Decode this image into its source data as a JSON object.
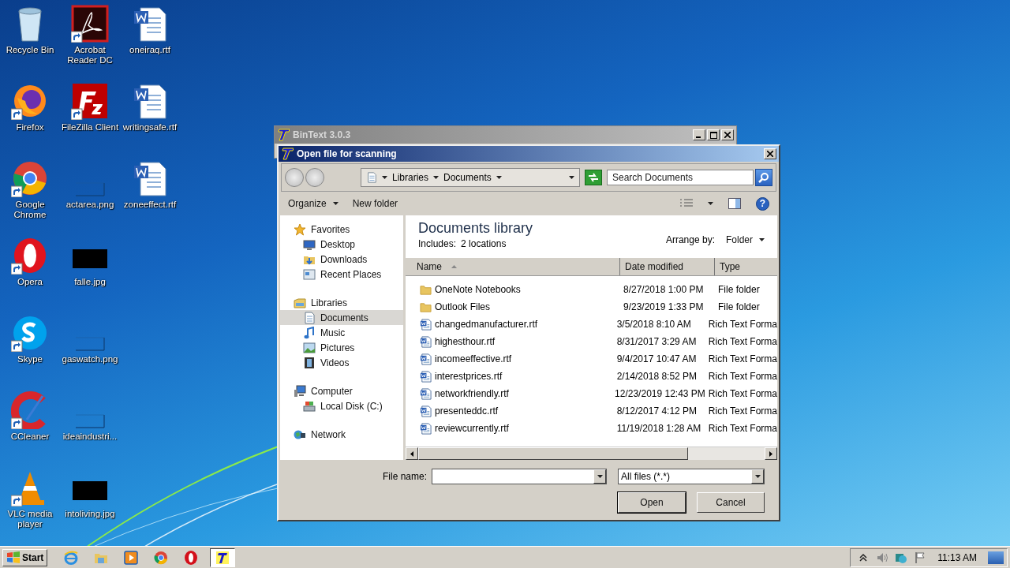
{
  "desktop": {
    "icons": [
      {
        "label": "Recycle Bin",
        "kind": "recycle",
        "shortcut": false
      },
      {
        "label": "Firefox",
        "kind": "firefox",
        "shortcut": true
      },
      {
        "label": "Google Chrome",
        "kind": "chrome",
        "shortcut": true
      },
      {
        "label": "Opera",
        "kind": "opera",
        "shortcut": true
      },
      {
        "label": "Skype",
        "kind": "skype",
        "shortcut": true
      },
      {
        "label": "CCleaner",
        "kind": "ccleaner",
        "shortcut": true
      },
      {
        "label": "VLC media player",
        "kind": "vlc",
        "shortcut": true
      },
      {
        "label": "Acrobat Reader DC",
        "kind": "acrobat",
        "shortcut": true
      },
      {
        "label": "FileZilla Client",
        "kind": "filezilla",
        "shortcut": true
      },
      {
        "label": "actarea.png",
        "kind": "blank",
        "shortcut": false
      },
      {
        "label": "falle.jpg",
        "kind": "dark",
        "shortcut": false
      },
      {
        "label": "gaswatch.png",
        "kind": "blank",
        "shortcut": false
      },
      {
        "label": "ideaindustri...",
        "kind": "blank",
        "shortcut": false
      },
      {
        "label": "intoliving.jpg",
        "kind": "dark",
        "shortcut": false
      },
      {
        "label": "oneiraq.rtf",
        "kind": "doc",
        "shortcut": false
      },
      {
        "label": "writingsafe.rtf",
        "kind": "doc",
        "shortcut": false
      },
      {
        "label": "zoneeffect.rtf",
        "kind": "doc",
        "shortcut": false
      }
    ]
  },
  "main_window": {
    "title": "BinText 3.0.3"
  },
  "dialog": {
    "title": "Open file for scanning",
    "breadcrumb": [
      "Libraries",
      "Documents"
    ],
    "search": {
      "placeholder": "Search Documents"
    },
    "toolbar": {
      "organize": "Organize",
      "new_folder": "New folder",
      "help": "?"
    },
    "nav_tree": [
      {
        "label": "Favorites",
        "kind": "star",
        "selected": false,
        "children": [
          {
            "label": "Desktop",
            "kind": "desktop",
            "selected": false
          },
          {
            "label": "Downloads",
            "kind": "downloads",
            "selected": false
          },
          {
            "label": "Recent Places",
            "kind": "recent",
            "selected": false
          }
        ]
      },
      {
        "label": "Libraries",
        "kind": "libraries",
        "selected": false,
        "children": [
          {
            "label": "Documents",
            "kind": "documents",
            "selected": true
          },
          {
            "label": "Music",
            "kind": "music",
            "selected": false
          },
          {
            "label": "Pictures",
            "kind": "pictures",
            "selected": false
          },
          {
            "label": "Videos",
            "kind": "videos",
            "selected": false
          }
        ]
      },
      {
        "label": "Computer",
        "kind": "computer",
        "selected": false,
        "children": [
          {
            "label": "Local Disk (C:)",
            "kind": "disk",
            "selected": false
          }
        ]
      },
      {
        "label": "Network",
        "kind": "network",
        "selected": false
      }
    ],
    "library": {
      "title": "Documents library",
      "includes_label": "Includes:",
      "includes_value": "2 locations",
      "arrange_label": "Arrange by:",
      "arrange_value": "Folder"
    },
    "table": {
      "columns": [
        "Name",
        "Date modified",
        "Type"
      ],
      "rows": [
        {
          "name": "OneNote Notebooks",
          "date": "8/27/2018 1:00 PM",
          "type": "File folder",
          "kind": "folder"
        },
        {
          "name": "Outlook Files",
          "date": "9/23/2019 1:33 PM",
          "type": "File folder",
          "kind": "folder"
        },
        {
          "name": "changedmanufacturer.rtf",
          "date": "3/5/2018 8:10 AM",
          "type": "Rich Text Forma",
          "kind": "doc"
        },
        {
          "name": "highesthour.rtf",
          "date": "8/31/2017 3:29 AM",
          "type": "Rich Text Forma",
          "kind": "doc"
        },
        {
          "name": "incomeeffective.rtf",
          "date": "9/4/2017 10:47 AM",
          "type": "Rich Text Forma",
          "kind": "doc"
        },
        {
          "name": "interestprices.rtf",
          "date": "2/14/2018 8:52 PM",
          "type": "Rich Text Forma",
          "kind": "doc"
        },
        {
          "name": "networkfriendly.rtf",
          "date": "12/23/2019 12:43 PM",
          "type": "Rich Text Forma",
          "kind": "doc"
        },
        {
          "name": "presenteddc.rtf",
          "date": "8/12/2017 4:12 PM",
          "type": "Rich Text Forma",
          "kind": "doc"
        },
        {
          "name": "reviewcurrently.rtf",
          "date": "11/19/2018 1:28 AM",
          "type": "Rich Text Forma",
          "kind": "doc"
        }
      ]
    },
    "file_name_label": "File name:",
    "file_type": "All files (*.*)",
    "buttons": [
      "Open",
      "Cancel"
    ]
  },
  "taskbar": {
    "start": "Start",
    "apps": [
      {
        "kind": "ie",
        "selected": false
      },
      {
        "kind": "explorer",
        "selected": false
      },
      {
        "kind": "media",
        "selected": false
      },
      {
        "kind": "chrome",
        "selected": false
      },
      {
        "kind": "opera",
        "selected": false
      },
      {
        "kind": "bintext",
        "selected": true
      }
    ],
    "clock": "11:13 AM"
  }
}
